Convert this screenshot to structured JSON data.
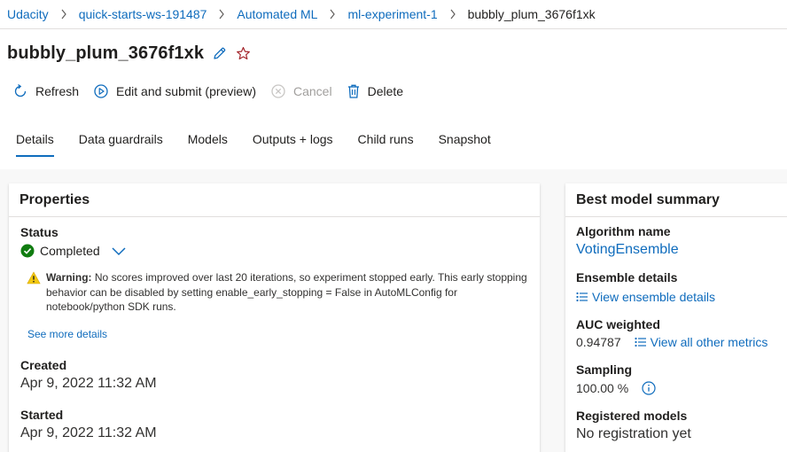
{
  "breadcrumb": {
    "items": [
      "Udacity",
      "quick-starts-ws-191487",
      "Automated ML",
      "ml-experiment-1"
    ],
    "current": "bubbly_plum_3676f1xk"
  },
  "run": {
    "title": "bubbly_plum_3676f1xk",
    "edit_icon": "pencil-icon",
    "favorite_icon": "star-icon"
  },
  "toolbar": {
    "refresh": "Refresh",
    "edit_submit": "Edit and submit (preview)",
    "cancel": "Cancel",
    "delete": "Delete"
  },
  "tabs": [
    "Details",
    "Data guardrails",
    "Models",
    "Outputs + logs",
    "Child runs",
    "Snapshot"
  ],
  "active_tab": "Details",
  "properties": {
    "header": "Properties",
    "status_label": "Status",
    "status_value": "Completed",
    "warning_prefix": "Warning:",
    "warning_text": "No scores improved over last 20 iterations, so experiment stopped early. This early stopping behavior can be disabled by setting enable_early_stopping = False in AutoMLConfig for notebook/python SDK runs.",
    "see_more": "See more details",
    "created_label": "Created",
    "created_value": "Apr 9, 2022 11:32 AM",
    "started_label": "Started",
    "started_value": "Apr 9, 2022 11:32 AM"
  },
  "best_model": {
    "header": "Best model summary",
    "algorithm_label": "Algorithm name",
    "algorithm_value": "VotingEnsemble",
    "ensemble_label": "Ensemble details",
    "ensemble_link": "View ensemble details",
    "auc_label": "AUC weighted",
    "auc_value": "0.94787",
    "metrics_link": "View all other metrics",
    "sampling_label": "Sampling",
    "sampling_value": "100.00 %",
    "registered_label": "Registered models",
    "registered_value": "No registration yet"
  },
  "colors": {
    "link": "#0f6cbd",
    "success": "#107c10",
    "warning": "#f2c811",
    "favorite": "#a4262c"
  }
}
